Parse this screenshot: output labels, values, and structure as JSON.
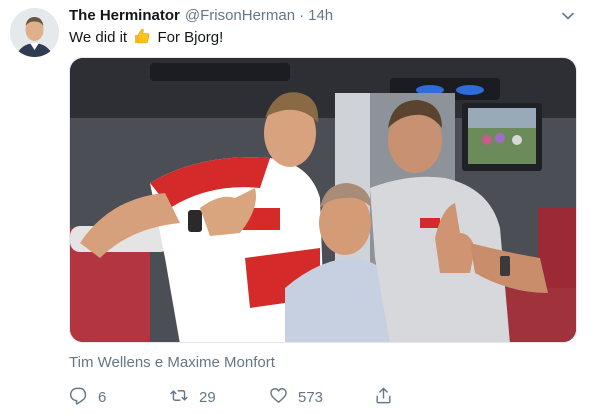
{
  "tweet": {
    "display_name": "The Herminator",
    "handle": "@FrisonHerman",
    "separator": "·",
    "time": "14h",
    "text_before": "We did it",
    "text_after": "For Bjorg!",
    "emoji": "thumbs-up-emoji",
    "media_caption": "Tim Wellens e Maxime Monfort"
  },
  "actions": {
    "replies": "6",
    "retweets": "29",
    "likes": "573"
  },
  "icons": {
    "reply": "reply-icon",
    "retweet": "retweet-icon",
    "like": "heart-icon",
    "share": "share-icon",
    "caret": "chevron-down-icon"
  },
  "colors": {
    "text": "#14171a",
    "secondary": "#657786",
    "jersey_red": "#d42a2a"
  }
}
